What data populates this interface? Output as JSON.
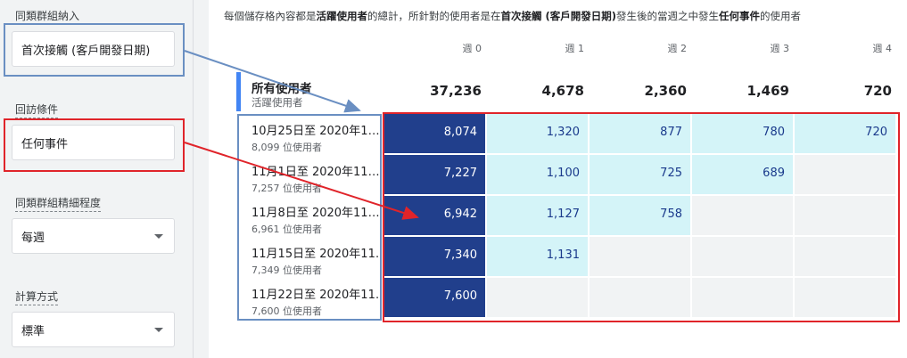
{
  "sidebar": {
    "cohort_inclusion": {
      "label": "同類群組納入",
      "value": "首次接觸 (客戶開發日期)"
    },
    "return_criteria": {
      "label": "回訪條件",
      "value": "任何事件"
    },
    "granularity": {
      "label": "同類群組精細程度",
      "value": "每週"
    },
    "calculation": {
      "label": "計算方式",
      "value": "標準"
    }
  },
  "description": {
    "p1": "每個儲存格內容都是",
    "b1": "活躍使用者",
    "p2": "的總計，所針對的使用者是在",
    "b2": "首次接觸 (客戶開發日期)",
    "p3": "發生後的當週之中發生",
    "b3": "任何事件",
    "p4": "的使用者"
  },
  "table": {
    "weeks": [
      "週 0",
      "週 1",
      "週 2",
      "週 3",
      "週 4"
    ],
    "total": {
      "title": "所有使用者",
      "subtitle": "活躍使用者",
      "values": [
        "37,236",
        "4,678",
        "2,360",
        "1,469",
        "720"
      ]
    },
    "rows": [
      {
        "label": "10月25日至 2020年1…",
        "users": "8,099 位使用者",
        "values": [
          "8,074",
          "1,320",
          "877",
          "780",
          "720"
        ]
      },
      {
        "label": "11月1日至 2020年11…",
        "users": "7,257 位使用者",
        "values": [
          "7,227",
          "1,100",
          "725",
          "689",
          ""
        ]
      },
      {
        "label": "11月8日至 2020年11…",
        "users": "6,961 位使用者",
        "values": [
          "6,942",
          "1,127",
          "758",
          "",
          ""
        ]
      },
      {
        "label": "11月15日至 2020年11…",
        "users": "7,349 位使用者",
        "values": [
          "7,340",
          "1,131",
          "",
          "",
          ""
        ]
      },
      {
        "label": "11月22日至 2020年11…",
        "users": "7,600 位使用者",
        "values": [
          "7,600",
          "",
          "",
          "",
          ""
        ]
      }
    ]
  },
  "colors": {
    "dark_cell": "#213f8c",
    "light_cell": "#d4f4f8",
    "empty_cell": "#f1f3f4",
    "annotation_blue": "#6a8fc2",
    "annotation_red": "#e0242a"
  }
}
